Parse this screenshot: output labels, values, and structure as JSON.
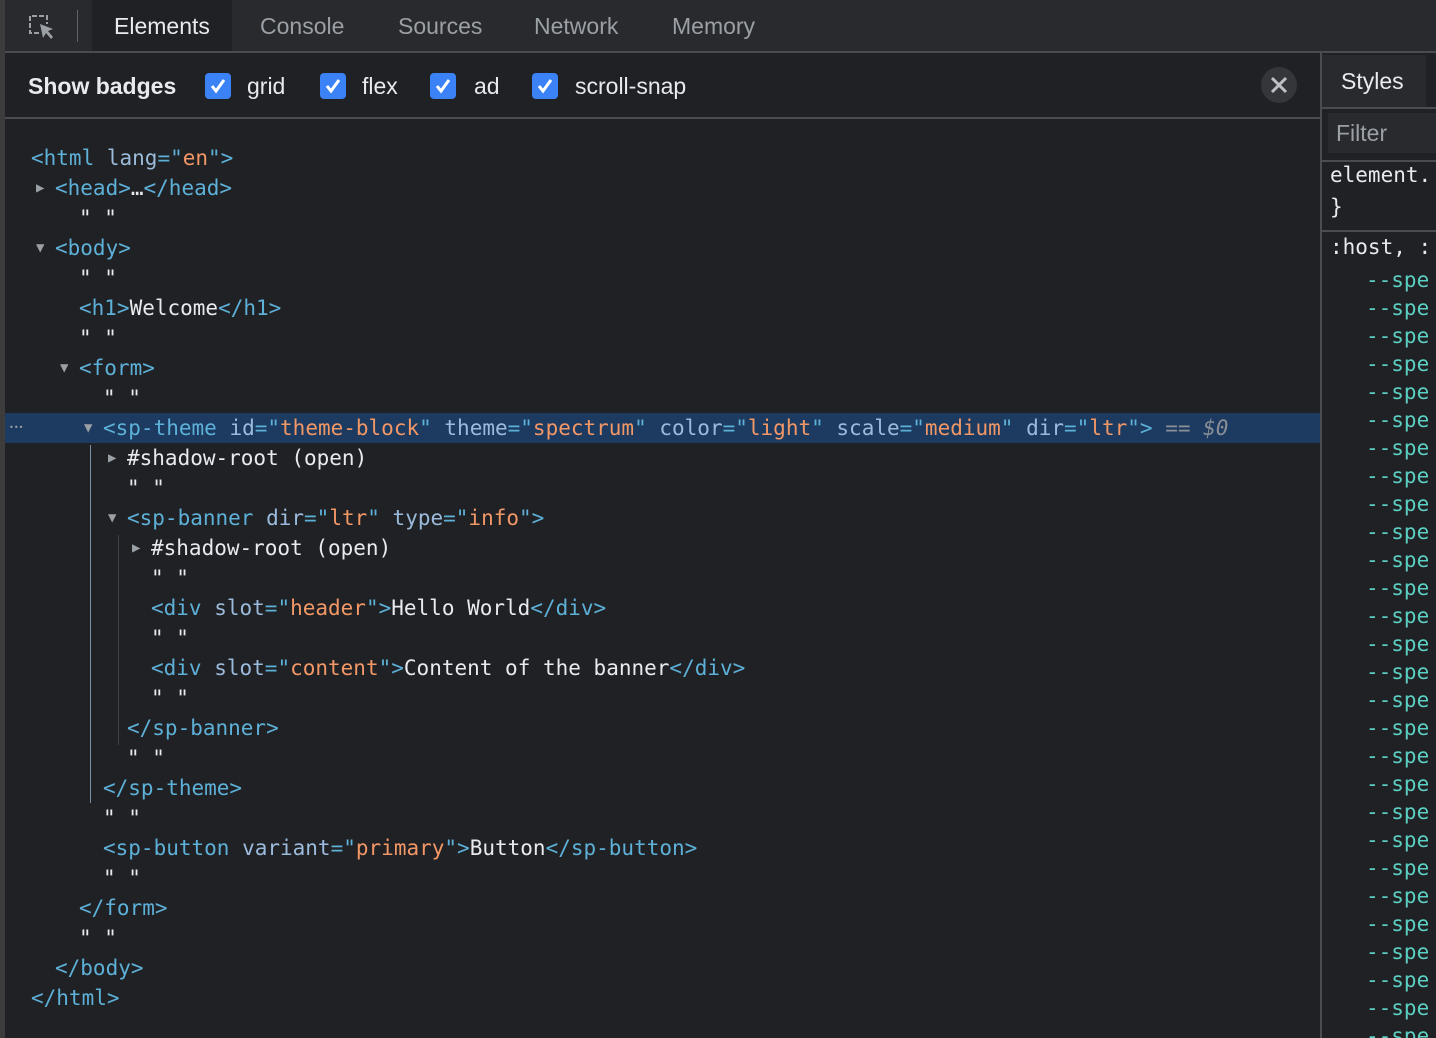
{
  "toolbar": {
    "tabs": [
      {
        "label": "Elements",
        "active": true
      },
      {
        "label": "Console"
      },
      {
        "label": "Sources"
      },
      {
        "label": "Network"
      },
      {
        "label": "Memory"
      }
    ]
  },
  "badges": {
    "label": "Show badges",
    "items": [
      {
        "label": "grid",
        "checked": true
      },
      {
        "label": "flex",
        "checked": true
      },
      {
        "label": "ad",
        "checked": true
      },
      {
        "label": "scroll-snap",
        "checked": true
      }
    ]
  },
  "tree": [
    {
      "level": -1,
      "tokens": [
        [
          "t",
          "<html "
        ],
        [
          "a",
          "lang"
        ],
        [
          "t",
          "=\""
        ],
        [
          "v",
          "en"
        ],
        [
          "t",
          "\">"
        ]
      ]
    },
    {
      "level": 0,
      "toggle": "collapsed",
      "tokens": [
        [
          "t",
          "<head>"
        ],
        [
          "x",
          "…"
        ],
        [
          "t",
          "</head>"
        ]
      ]
    },
    {
      "level": 1,
      "tokens": [
        [
          "x",
          "\" \""
        ]
      ]
    },
    {
      "level": 0,
      "toggle": "expanded",
      "tokens": [
        [
          "t",
          "<body>"
        ]
      ]
    },
    {
      "level": 1,
      "tokens": [
        [
          "x",
          "\" \""
        ]
      ]
    },
    {
      "level": 1,
      "tokens": [
        [
          "t",
          "<h1>"
        ],
        [
          "x",
          "Welcome"
        ],
        [
          "t",
          "</h1>"
        ]
      ]
    },
    {
      "level": 1,
      "tokens": [
        [
          "x",
          "\" \""
        ]
      ]
    },
    {
      "level": 1,
      "toggle": "expanded",
      "tokens": [
        [
          "t",
          "<form>"
        ]
      ]
    },
    {
      "level": 2,
      "tokens": [
        [
          "x",
          "\" \""
        ]
      ]
    },
    {
      "level": 2,
      "toggle": "expanded",
      "selected": true,
      "tokens": [
        [
          "t",
          "<sp-theme "
        ],
        [
          "a",
          "id"
        ],
        [
          "t",
          "=\""
        ],
        [
          "v",
          "theme-block"
        ],
        [
          "t",
          "\" "
        ],
        [
          "a",
          "theme"
        ],
        [
          "t",
          "=\""
        ],
        [
          "v",
          "spectrum"
        ],
        [
          "t",
          "\" "
        ],
        [
          "a",
          "color"
        ],
        [
          "t",
          "=\""
        ],
        [
          "v",
          "light"
        ],
        [
          "t",
          "\" "
        ],
        [
          "a",
          "scale"
        ],
        [
          "t",
          "=\""
        ],
        [
          "v",
          "medium"
        ],
        [
          "t",
          "\" "
        ],
        [
          "a",
          "dir"
        ],
        [
          "t",
          "=\""
        ],
        [
          "v",
          "ltr"
        ],
        [
          "t",
          "\">"
        ],
        [
          "d",
          " == $0"
        ]
      ]
    },
    {
      "level": 3,
      "toggle": "collapsed",
      "tokens": [
        [
          "x",
          "#shadow-root (open)"
        ]
      ]
    },
    {
      "level": 3,
      "tokens": [
        [
          "x",
          "\" \""
        ]
      ]
    },
    {
      "level": 3,
      "toggle": "expanded",
      "tokens": [
        [
          "t",
          "<sp-banner "
        ],
        [
          "a",
          "dir"
        ],
        [
          "t",
          "=\""
        ],
        [
          "v",
          "ltr"
        ],
        [
          "t",
          "\" "
        ],
        [
          "a",
          "type"
        ],
        [
          "t",
          "=\""
        ],
        [
          "v",
          "info"
        ],
        [
          "t",
          "\">"
        ]
      ]
    },
    {
      "level": 4,
      "toggle": "collapsed",
      "tokens": [
        [
          "x",
          "#shadow-root (open)"
        ]
      ]
    },
    {
      "level": 4,
      "tokens": [
        [
          "x",
          "\" \""
        ]
      ]
    },
    {
      "level": 4,
      "tokens": [
        [
          "t",
          "<div "
        ],
        [
          "a",
          "slot"
        ],
        [
          "t",
          "=\""
        ],
        [
          "v",
          "header"
        ],
        [
          "t",
          "\">"
        ],
        [
          "x",
          "Hello World"
        ],
        [
          "t",
          "</div>"
        ]
      ]
    },
    {
      "level": 4,
      "tokens": [
        [
          "x",
          "\" \""
        ]
      ]
    },
    {
      "level": 4,
      "tokens": [
        [
          "t",
          "<div "
        ],
        [
          "a",
          "slot"
        ],
        [
          "t",
          "=\""
        ],
        [
          "v",
          "content"
        ],
        [
          "t",
          "\">"
        ],
        [
          "x",
          "Content of the banner"
        ],
        [
          "t",
          "</div>"
        ]
      ]
    },
    {
      "level": 4,
      "tokens": [
        [
          "x",
          "\" \""
        ]
      ]
    },
    {
      "level": 3,
      "tokens": [
        [
          "t",
          "</sp-banner>"
        ]
      ]
    },
    {
      "level": 3,
      "tokens": [
        [
          "x",
          "\" \""
        ]
      ]
    },
    {
      "level": 2,
      "tokens": [
        [
          "t",
          "</sp-theme>"
        ]
      ]
    },
    {
      "level": 2,
      "tokens": [
        [
          "x",
          "\" \""
        ]
      ]
    },
    {
      "level": 2,
      "tokens": [
        [
          "t",
          "<sp-button "
        ],
        [
          "a",
          "variant"
        ],
        [
          "t",
          "=\""
        ],
        [
          "v",
          "primary"
        ],
        [
          "t",
          "\">"
        ],
        [
          "x",
          "Button"
        ],
        [
          "t",
          "</sp-button>"
        ]
      ]
    },
    {
      "level": 2,
      "tokens": [
        [
          "x",
          "\" \""
        ]
      ]
    },
    {
      "level": 1,
      "tokens": [
        [
          "t",
          "</form>"
        ]
      ]
    },
    {
      "level": 1,
      "tokens": [
        [
          "x",
          "\" \""
        ]
      ]
    },
    {
      "level": 0,
      "tokens": [
        [
          "t",
          "</body>"
        ]
      ]
    },
    {
      "level": -1,
      "tokens": [
        [
          "t",
          "</html>"
        ]
      ]
    }
  ],
  "styles": {
    "tab": "Styles",
    "filter_placeholder": "Filter",
    "rule1_selector": "element.",
    "rule1_close": "}",
    "rule2_selector": ":host, :",
    "property_prefix": "--spe",
    "property_count": 28
  },
  "colors": {
    "tag": "#5db0d7",
    "attr": "#9bbbdc",
    "value": "#f29766",
    "selection": "#1d3b60",
    "checkbox": "#3b82f6"
  }
}
